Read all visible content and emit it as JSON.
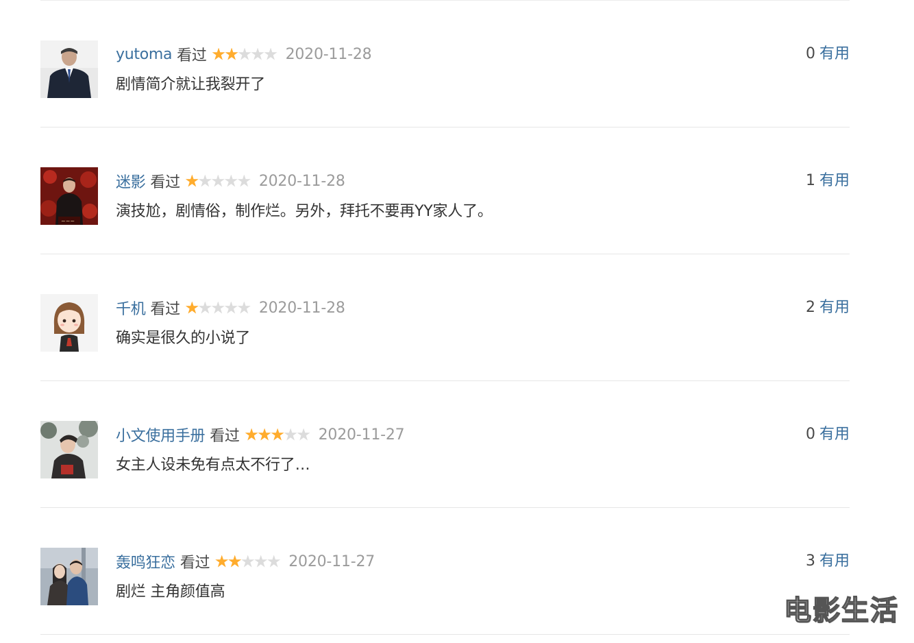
{
  "useful_label": "有用",
  "watched_label": "看过",
  "watermark": "电影生活",
  "colors": {
    "link": "#3a6f9e",
    "star_on": "#ffac2d",
    "star_off": "#dcdcdc",
    "date": "#9b9b9b",
    "text": "#333333"
  },
  "comments": [
    {
      "author": "yutoma",
      "avatar_icon": "user-avatar-photo-man-in-suit",
      "rating": 2,
      "date": "2020-11-28",
      "text": "剧情简介就让我裂开了",
      "votes": "0"
    },
    {
      "author": "迷影",
      "avatar_icon": "user-avatar-poster-red",
      "rating": 1,
      "date": "2020-11-28",
      "text": "演技尬，剧情俗，制作烂。另外，拜托不要再YY家人了。",
      "votes": "1"
    },
    {
      "author": "千机",
      "avatar_icon": "user-avatar-cartoon-girl",
      "rating": 1,
      "date": "2020-11-28",
      "text": "确实是很久的小说了",
      "votes": "2"
    },
    {
      "author": "小文使用手册",
      "avatar_icon": "user-avatar-photo-man-outdoor",
      "rating": 3,
      "date": "2020-11-27",
      "text": "女主人设未免有点太不行了…",
      "votes": "0"
    },
    {
      "author": "轰鸣狂恋",
      "avatar_icon": "user-avatar-photo-couple",
      "rating": 2,
      "date": "2020-11-27",
      "text": "剧烂 主角颜值高",
      "votes": "3"
    }
  ]
}
